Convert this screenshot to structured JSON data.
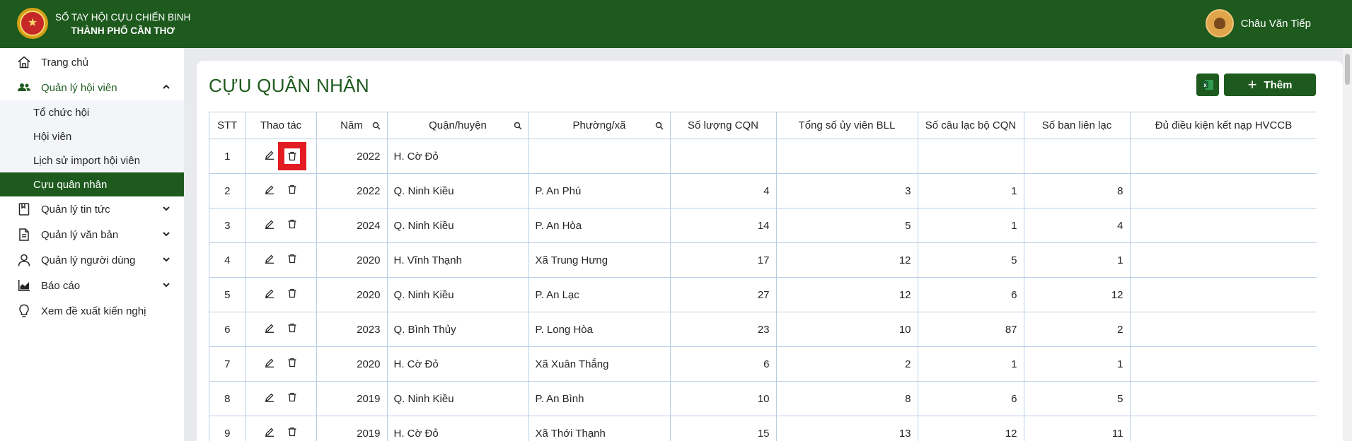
{
  "header": {
    "brand_line1": "SỔ TAY HỘI CỰU CHIẾN BINH",
    "brand_line2": "THÀNH PHỐ CẦN THƠ",
    "user_name": "Châu Văn Tiếp"
  },
  "sidebar": {
    "items": [
      {
        "label": "Trang chủ",
        "icon": "home-icon"
      },
      {
        "label": "Quản lý hội viên",
        "icon": "users-icon",
        "expanded": true
      },
      {
        "label": "Quản lý tin tức",
        "icon": "book-icon"
      },
      {
        "label": "Quản lý văn bản",
        "icon": "document-icon"
      },
      {
        "label": "Quản lý người dùng",
        "icon": "user-icon"
      },
      {
        "label": "Báo cáo",
        "icon": "chart-icon"
      },
      {
        "label": "Xem đề xuất kiến nghị",
        "icon": "lightbulb-icon"
      }
    ],
    "submenu": [
      {
        "label": "Tổ chức hội"
      },
      {
        "label": "Hội viên"
      },
      {
        "label": "Lịch sử import hội viên"
      },
      {
        "label": "Cựu quân nhân",
        "active": true
      }
    ]
  },
  "main": {
    "title": "CỰU QUÂN NHÂN",
    "add_label": "Thêm",
    "excel_icon": "excel-icon",
    "accent_color": "#1e5a1e"
  },
  "table": {
    "columns": [
      "STT",
      "Thao tác",
      "Năm",
      "Quận/huyện",
      "Phường/xã",
      "Số lượng CQN",
      "Tổng số ủy viên BLL",
      "Số câu lạc bộ CQN",
      "Số ban liên lạc",
      "Đủ điều kiện kết nạp HVCCB"
    ],
    "rows": [
      {
        "stt": "1",
        "nam": "2022",
        "quan": "H. Cờ Đỏ",
        "phuong": "",
        "cqn": "",
        "bll": "",
        "clb": "",
        "ban": "",
        "du": ""
      },
      {
        "stt": "2",
        "nam": "2022",
        "quan": "Q. Ninh Kiều",
        "phuong": "P. An Phú",
        "cqn": "4",
        "bll": "3",
        "clb": "1",
        "ban": "8",
        "du": ""
      },
      {
        "stt": "3",
        "nam": "2024",
        "quan": "Q. Ninh Kiều",
        "phuong": "P. An Hòa",
        "cqn": "14",
        "bll": "5",
        "clb": "1",
        "ban": "4",
        "du": ""
      },
      {
        "stt": "4",
        "nam": "2020",
        "quan": "H. Vĩnh Thạnh",
        "phuong": "Xã Trung Hưng",
        "cqn": "17",
        "bll": "12",
        "clb": "5",
        "ban": "1",
        "du": ""
      },
      {
        "stt": "5",
        "nam": "2020",
        "quan": "Q. Ninh Kiều",
        "phuong": "P. An Lạc",
        "cqn": "27",
        "bll": "12",
        "clb": "6",
        "ban": "12",
        "du": ""
      },
      {
        "stt": "6",
        "nam": "2023",
        "quan": "Q. Bình Thủy",
        "phuong": "P. Long Hòa",
        "cqn": "23",
        "bll": "10",
        "clb": "87",
        "ban": "2",
        "du": ""
      },
      {
        "stt": "7",
        "nam": "2020",
        "quan": "H. Cờ Đỏ",
        "phuong": "Xã Xuân Thắng",
        "cqn": "6",
        "bll": "2",
        "clb": "1",
        "ban": "1",
        "du": ""
      },
      {
        "stt": "8",
        "nam": "2019",
        "quan": "Q. Ninh Kiều",
        "phuong": "P. An Bình",
        "cqn": "10",
        "bll": "8",
        "clb": "6",
        "ban": "5",
        "du": ""
      },
      {
        "stt": "9",
        "nam": "2019",
        "quan": "H. Cờ Đỏ",
        "phuong": "Xã Thới Thạnh",
        "cqn": "15",
        "bll": "13",
        "clb": "12",
        "ban": "11",
        "du": ""
      }
    ]
  }
}
